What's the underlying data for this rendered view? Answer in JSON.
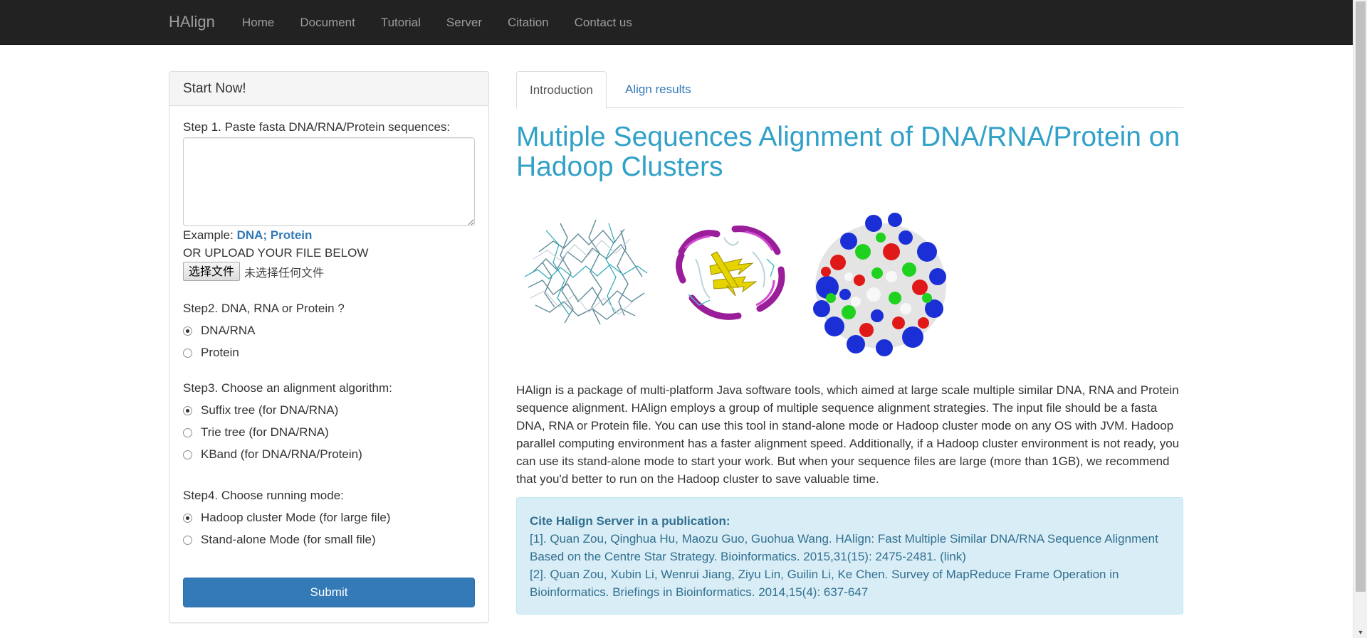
{
  "navbar": {
    "brand": "HAlign",
    "links": [
      "Home",
      "Document",
      "Tutorial",
      "Server",
      "Citation",
      "Contact us"
    ]
  },
  "panel": {
    "heading": "Start Now!",
    "step1_label": "Step 1. Paste fasta DNA/RNA/Protein sequences:",
    "textarea_value": "",
    "example_prefix": "Example: ",
    "example_dna": "DNA",
    "example_separator": "; ",
    "example_protein": "Protein",
    "upload_label": "OR UPLOAD YOUR FILE BELOW",
    "file_button": "选择文件",
    "file_status": "未选择任何文件",
    "step2_label": "Step2. DNA, RNA or Protein ?",
    "step2_options": [
      {
        "label": "DNA/RNA",
        "checked": true
      },
      {
        "label": "Protein",
        "checked": false
      }
    ],
    "step3_label": "Step3. Choose an alignment algorithm:",
    "step3_options": [
      {
        "label": "Suffix tree (for DNA/RNA)",
        "checked": true
      },
      {
        "label": "Trie tree (for DNA/RNA)",
        "checked": false
      },
      {
        "label": "KBand (for DNA/RNA/Protein)",
        "checked": false
      }
    ],
    "step4_label": "Step4. Choose running mode:",
    "step4_options": [
      {
        "label": "Hadoop cluster Mode (for large file)",
        "checked": true
      },
      {
        "label": "Stand-alone Mode (for small file)",
        "checked": false
      }
    ],
    "submit_label": "Submit"
  },
  "tabs": [
    {
      "label": "Introduction",
      "active": true
    },
    {
      "label": "Align results",
      "active": false
    }
  ],
  "main": {
    "title": "Mutiple Sequences Alignment of DNA/RNA/Protein on Hadoop Clusters",
    "intro": "HAlign is a package of multi-platform Java software tools, which aimed at large scale multiple similar DNA, RNA and Protein sequence alignment. HAlign employs a group of multiple sequence alignment strategies. The input file should be a fasta DNA, RNA or Protein file. You can use this tool in stand-alone mode or Hadoop cluster mode on any OS with JVM. Hadoop parallel computing environment has a faster alignment speed. Additionally, if a Hadoop cluster environment is not ready, you can use its stand-alone mode to start your work. But when your sequence files are large (more than 1GB), we recommend that you'd better to run on the Hadoop cluster to save valuable time."
  },
  "citation": {
    "title": "Cite Halign Server in a publication:",
    "ref1_text": "[1]. Quan Zou, Qinghua Hu, Maozu Guo, Guohua Wang. HAlign: Fast Multiple Similar DNA/RNA Sequence Alignment Based on the Centre Star Strategy. Bioinformatics. 2015,31(15): 2475-2481. ",
    "ref1_link": "(link)",
    "ref2_text": "[2]. Quan Zou, Xubin Li, Wenrui Jiang, Ziyu Lin, Guilin Li, Ke Chen. Survey of MapReduce Frame Operation in Bioinformatics. Briefings in Bioinformatics. 2014,15(4): 637-647"
  },
  "colors": {
    "navbar_bg": "#222222",
    "link": "#337ab7",
    "title": "#31a1c8",
    "cite_bg": "#d9edf7",
    "cite_text": "#31708f"
  },
  "figures": [
    "stick-protein-structure",
    "ribbon-protein-structure",
    "surface-protein-structure"
  ]
}
